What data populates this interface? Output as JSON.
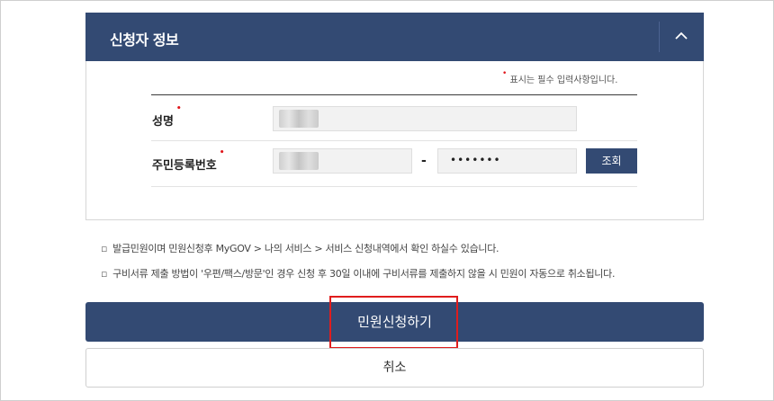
{
  "section": {
    "title": "신청자 정보",
    "collapse_icon": "chevron-up-icon"
  },
  "required_note": {
    "marker": "•",
    "text": "표시는 필수 입력사항입니다."
  },
  "form": {
    "name_label": "성명",
    "rrn_label": "주민등록번호",
    "required_marker": "•",
    "separator": "-",
    "rrn_back_masked": "•••••••",
    "lookup_label": "조회"
  },
  "notes": [
    {
      "bullet": "▫",
      "text": "발급민원이며 민원신청후 MyGOV > 나의 서비스 > 서비스 신청내역에서 확인 하실수 있습니다."
    },
    {
      "bullet": "▫",
      "text": "구비서류 제출 방법이 '우편/팩스/방문'인 경우 신청 후 30일 이내에 구비서류를 제출하지 않을 시 민원이 자동으로 취소됩니다."
    }
  ],
  "actions": {
    "submit_label": "민원신청하기",
    "cancel_label": "취소"
  },
  "colors": {
    "primary": "#334a73",
    "required": "#e0161b",
    "highlight": "#e01d1d"
  }
}
